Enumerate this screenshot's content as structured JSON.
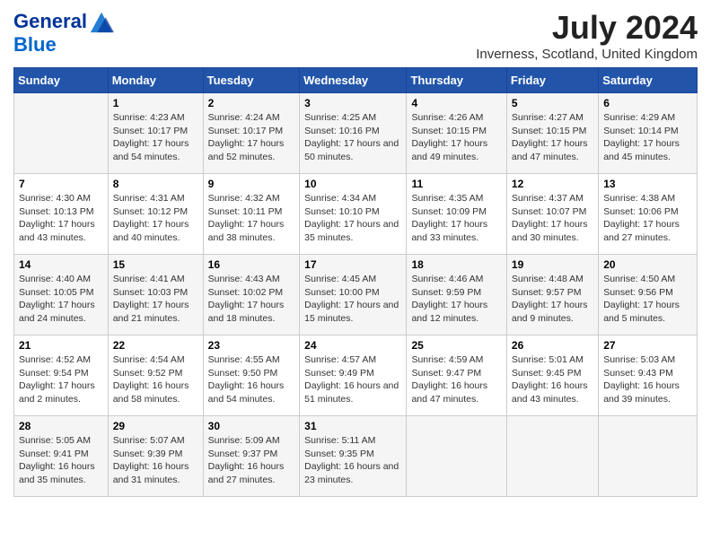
{
  "header": {
    "logo_line1": "General",
    "logo_line2": "Blue",
    "month_year": "July 2024",
    "location": "Inverness, Scotland, United Kingdom"
  },
  "days_of_week": [
    "Sunday",
    "Monday",
    "Tuesday",
    "Wednesday",
    "Thursday",
    "Friday",
    "Saturday"
  ],
  "weeks": [
    [
      {
        "date": "",
        "sunrise": "",
        "sunset": "",
        "daylight": ""
      },
      {
        "date": "1",
        "sunrise": "Sunrise: 4:23 AM",
        "sunset": "Sunset: 10:17 PM",
        "daylight": "Daylight: 17 hours and 54 minutes."
      },
      {
        "date": "2",
        "sunrise": "Sunrise: 4:24 AM",
        "sunset": "Sunset: 10:17 PM",
        "daylight": "Daylight: 17 hours and 52 minutes."
      },
      {
        "date": "3",
        "sunrise": "Sunrise: 4:25 AM",
        "sunset": "Sunset: 10:16 PM",
        "daylight": "Daylight: 17 hours and 50 minutes."
      },
      {
        "date": "4",
        "sunrise": "Sunrise: 4:26 AM",
        "sunset": "Sunset: 10:15 PM",
        "daylight": "Daylight: 17 hours and 49 minutes."
      },
      {
        "date": "5",
        "sunrise": "Sunrise: 4:27 AM",
        "sunset": "Sunset: 10:15 PM",
        "daylight": "Daylight: 17 hours and 47 minutes."
      },
      {
        "date": "6",
        "sunrise": "Sunrise: 4:29 AM",
        "sunset": "Sunset: 10:14 PM",
        "daylight": "Daylight: 17 hours and 45 minutes."
      }
    ],
    [
      {
        "date": "7",
        "sunrise": "Sunrise: 4:30 AM",
        "sunset": "Sunset: 10:13 PM",
        "daylight": "Daylight: 17 hours and 43 minutes."
      },
      {
        "date": "8",
        "sunrise": "Sunrise: 4:31 AM",
        "sunset": "Sunset: 10:12 PM",
        "daylight": "Daylight: 17 hours and 40 minutes."
      },
      {
        "date": "9",
        "sunrise": "Sunrise: 4:32 AM",
        "sunset": "Sunset: 10:11 PM",
        "daylight": "Daylight: 17 hours and 38 minutes."
      },
      {
        "date": "10",
        "sunrise": "Sunrise: 4:34 AM",
        "sunset": "Sunset: 10:10 PM",
        "daylight": "Daylight: 17 hours and 35 minutes."
      },
      {
        "date": "11",
        "sunrise": "Sunrise: 4:35 AM",
        "sunset": "Sunset: 10:09 PM",
        "daylight": "Daylight: 17 hours and 33 minutes."
      },
      {
        "date": "12",
        "sunrise": "Sunrise: 4:37 AM",
        "sunset": "Sunset: 10:07 PM",
        "daylight": "Daylight: 17 hours and 30 minutes."
      },
      {
        "date": "13",
        "sunrise": "Sunrise: 4:38 AM",
        "sunset": "Sunset: 10:06 PM",
        "daylight": "Daylight: 17 hours and 27 minutes."
      }
    ],
    [
      {
        "date": "14",
        "sunrise": "Sunrise: 4:40 AM",
        "sunset": "Sunset: 10:05 PM",
        "daylight": "Daylight: 17 hours and 24 minutes."
      },
      {
        "date": "15",
        "sunrise": "Sunrise: 4:41 AM",
        "sunset": "Sunset: 10:03 PM",
        "daylight": "Daylight: 17 hours and 21 minutes."
      },
      {
        "date": "16",
        "sunrise": "Sunrise: 4:43 AM",
        "sunset": "Sunset: 10:02 PM",
        "daylight": "Daylight: 17 hours and 18 minutes."
      },
      {
        "date": "17",
        "sunrise": "Sunrise: 4:45 AM",
        "sunset": "Sunset: 10:00 PM",
        "daylight": "Daylight: 17 hours and 15 minutes."
      },
      {
        "date": "18",
        "sunrise": "Sunrise: 4:46 AM",
        "sunset": "Sunset: 9:59 PM",
        "daylight": "Daylight: 17 hours and 12 minutes."
      },
      {
        "date": "19",
        "sunrise": "Sunrise: 4:48 AM",
        "sunset": "Sunset: 9:57 PM",
        "daylight": "Daylight: 17 hours and 9 minutes."
      },
      {
        "date": "20",
        "sunrise": "Sunrise: 4:50 AM",
        "sunset": "Sunset: 9:56 PM",
        "daylight": "Daylight: 17 hours and 5 minutes."
      }
    ],
    [
      {
        "date": "21",
        "sunrise": "Sunrise: 4:52 AM",
        "sunset": "Sunset: 9:54 PM",
        "daylight": "Daylight: 17 hours and 2 minutes."
      },
      {
        "date": "22",
        "sunrise": "Sunrise: 4:54 AM",
        "sunset": "Sunset: 9:52 PM",
        "daylight": "Daylight: 16 hours and 58 minutes."
      },
      {
        "date": "23",
        "sunrise": "Sunrise: 4:55 AM",
        "sunset": "Sunset: 9:50 PM",
        "daylight": "Daylight: 16 hours and 54 minutes."
      },
      {
        "date": "24",
        "sunrise": "Sunrise: 4:57 AM",
        "sunset": "Sunset: 9:49 PM",
        "daylight": "Daylight: 16 hours and 51 minutes."
      },
      {
        "date": "25",
        "sunrise": "Sunrise: 4:59 AM",
        "sunset": "Sunset: 9:47 PM",
        "daylight": "Daylight: 16 hours and 47 minutes."
      },
      {
        "date": "26",
        "sunrise": "Sunrise: 5:01 AM",
        "sunset": "Sunset: 9:45 PM",
        "daylight": "Daylight: 16 hours and 43 minutes."
      },
      {
        "date": "27",
        "sunrise": "Sunrise: 5:03 AM",
        "sunset": "Sunset: 9:43 PM",
        "daylight": "Daylight: 16 hours and 39 minutes."
      }
    ],
    [
      {
        "date": "28",
        "sunrise": "Sunrise: 5:05 AM",
        "sunset": "Sunset: 9:41 PM",
        "daylight": "Daylight: 16 hours and 35 minutes."
      },
      {
        "date": "29",
        "sunrise": "Sunrise: 5:07 AM",
        "sunset": "Sunset: 9:39 PM",
        "daylight": "Daylight: 16 hours and 31 minutes."
      },
      {
        "date": "30",
        "sunrise": "Sunrise: 5:09 AM",
        "sunset": "Sunset: 9:37 PM",
        "daylight": "Daylight: 16 hours and 27 minutes."
      },
      {
        "date": "31",
        "sunrise": "Sunrise: 5:11 AM",
        "sunset": "Sunset: 9:35 PM",
        "daylight": "Daylight: 16 hours and 23 minutes."
      },
      {
        "date": "",
        "sunrise": "",
        "sunset": "",
        "daylight": ""
      },
      {
        "date": "",
        "sunrise": "",
        "sunset": "",
        "daylight": ""
      },
      {
        "date": "",
        "sunrise": "",
        "sunset": "",
        "daylight": ""
      }
    ]
  ]
}
